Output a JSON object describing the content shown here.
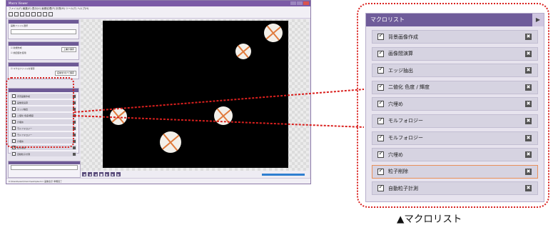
{
  "app": {
    "title": "Macro Viewer",
    "menu": "ファイル(F)  編集(E)  表示(V)  画像処理(P)  計測(M)  ツール(T)  ヘルプ(H)",
    "left_panel": {
      "section1_lines": [
        "画像ファイル選択"
      ],
      "section2_lines": [
        "☑ 新規作成",
        "☑ 前回値を使用",
        "☑ マクロファイルを保存"
      ],
      "buttons": [
        "上書き保存",
        "名前を付けて保存"
      ]
    },
    "thumb_macros": [
      "背景画像作成",
      "画像間演算",
      "エッジ抽出",
      "二値化 色度/輝度",
      "穴埋め",
      "モルフォロジー",
      "モルフォロジー",
      "穴埋め",
      "粒子削除",
      "自動粒子計測"
    ],
    "bottom_buttons": [
      "実行",
      "全実行"
    ],
    "statusbar": "C:\\Users\\user\\macro\\sample.mcr  画像表示  準備完了"
  },
  "macro_list": {
    "title": "マクロリスト",
    "arrow": "▶",
    "items": [
      {
        "label": "背景画像作成",
        "checked": true,
        "selected": false
      },
      {
        "label": "画像間演算",
        "checked": true,
        "selected": false
      },
      {
        "label": "エッジ抽出",
        "checked": true,
        "selected": false
      },
      {
        "label": "二値化 色度 / 輝度",
        "checked": true,
        "selected": false
      },
      {
        "label": "穴埋め",
        "checked": true,
        "selected": false
      },
      {
        "label": "モルフォロジー",
        "checked": true,
        "selected": false
      },
      {
        "label": "モルフォロジー",
        "checked": true,
        "selected": false
      },
      {
        "label": "穴埋め",
        "checked": true,
        "selected": false
      },
      {
        "label": "粒子削除",
        "checked": true,
        "selected": true
      },
      {
        "label": "自動粒子計測",
        "checked": true,
        "selected": false
      }
    ],
    "delete_glyph": "✖"
  },
  "caption": "▲マクロリスト",
  "colors": {
    "accent": "#6f5c9a",
    "highlight": "#d9201e",
    "selected_border": "#e8905a"
  }
}
